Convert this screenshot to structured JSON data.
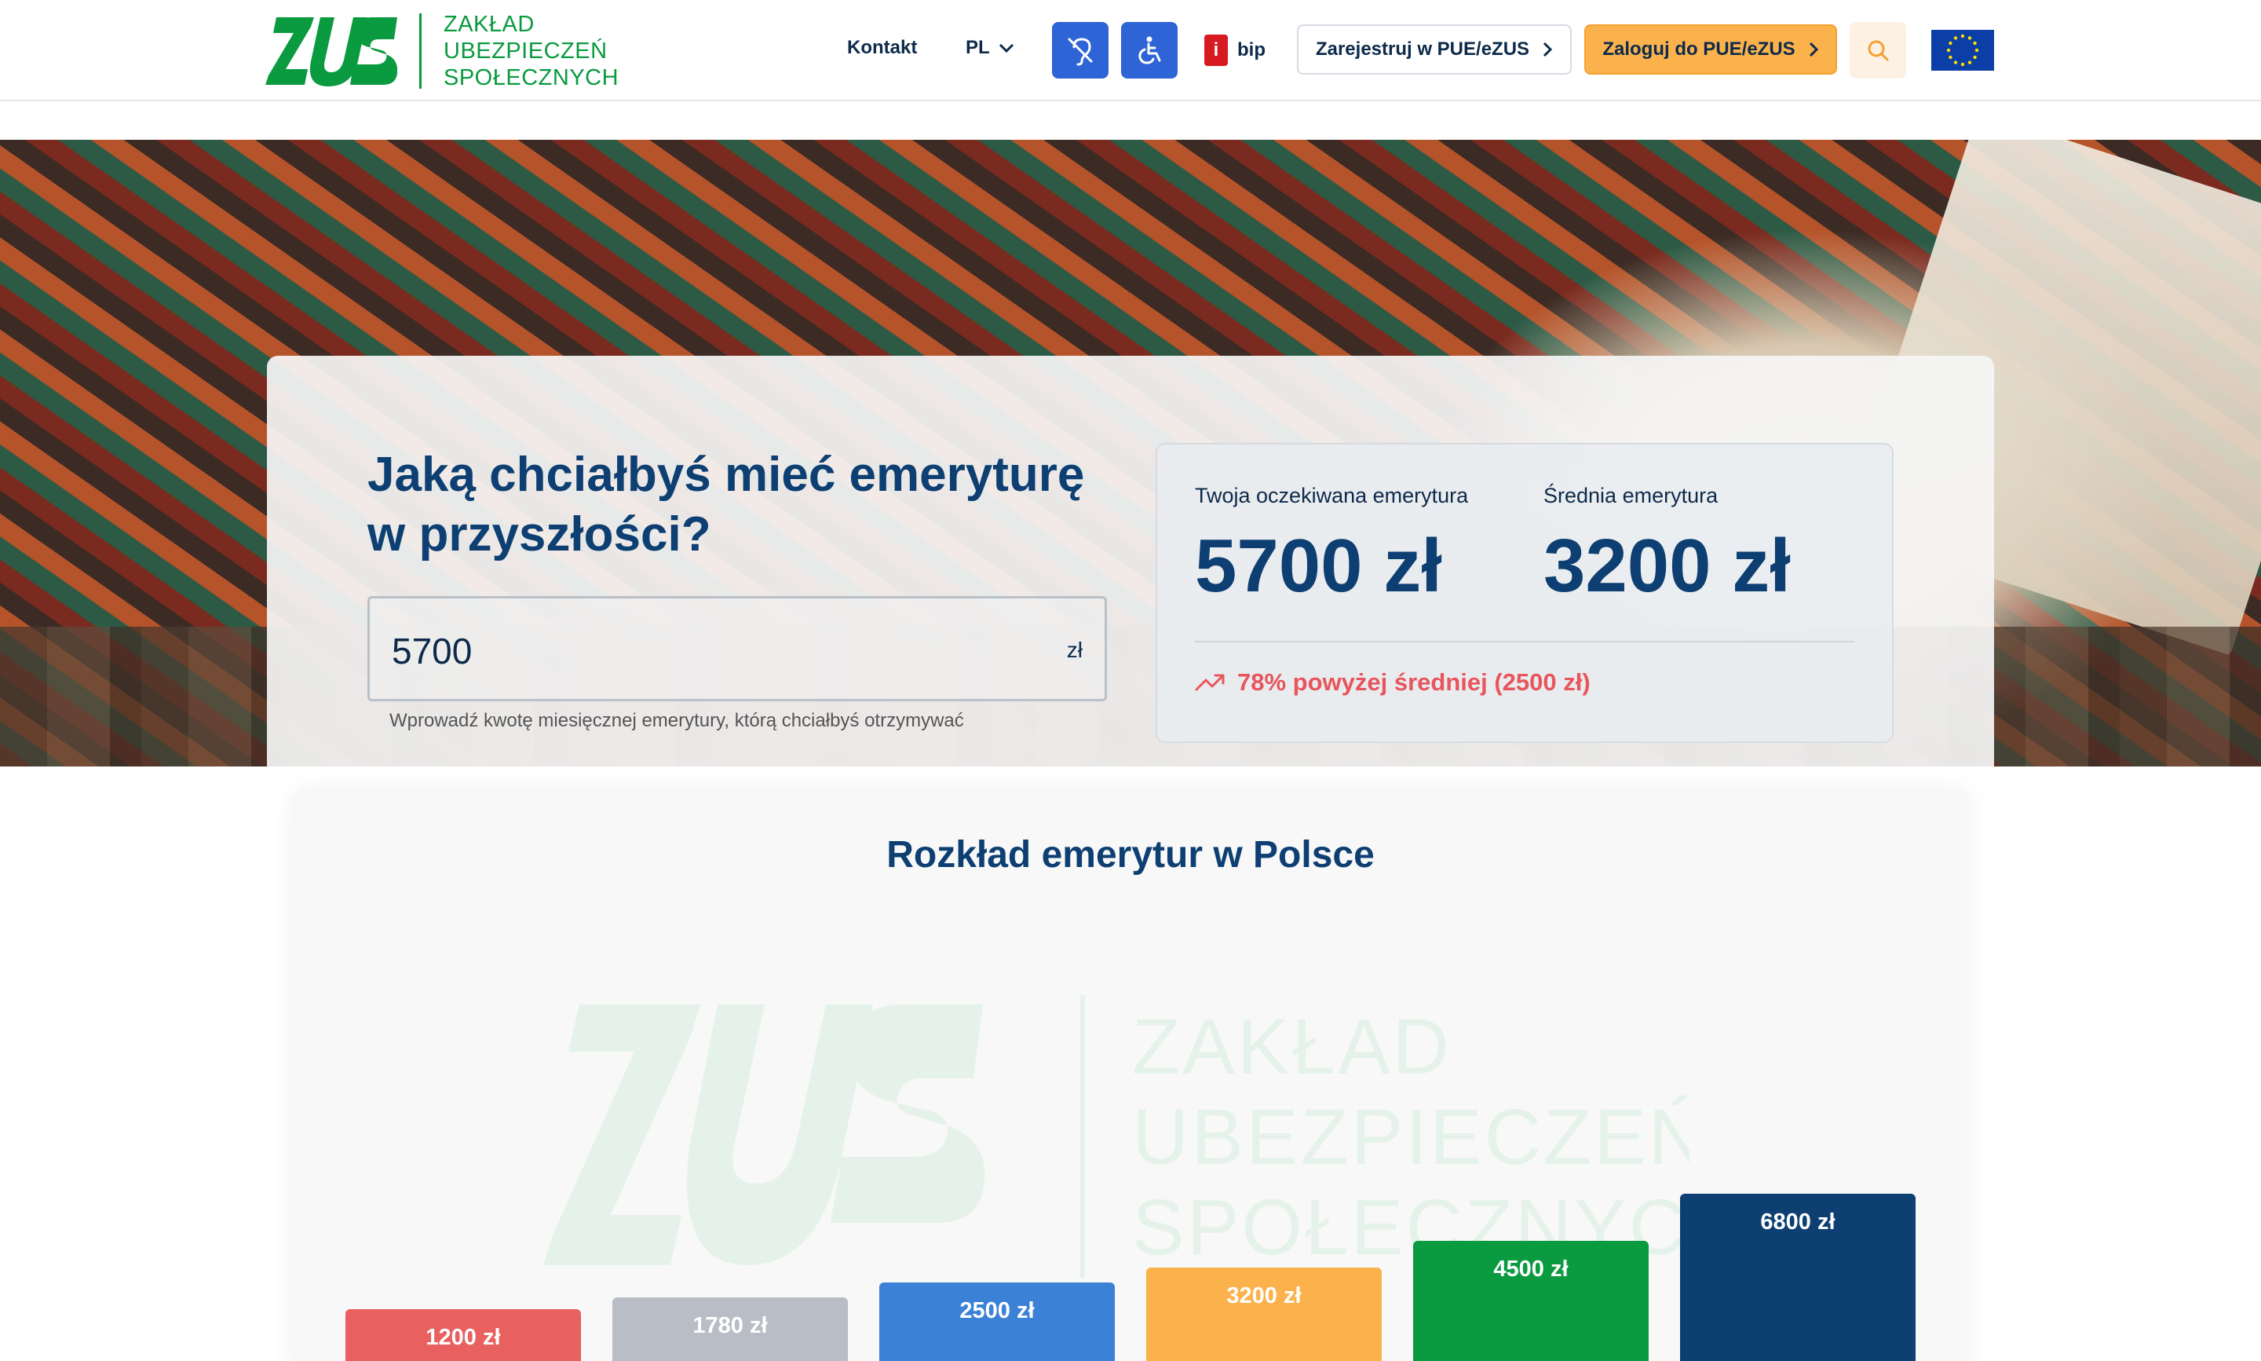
{
  "header": {
    "logo": {
      "mark": "ZUS",
      "lines": [
        "ZAKŁAD",
        "UBEZPIECZEŃ",
        "SPOŁECZNYCH"
      ],
      "color": "#0a9a3f"
    },
    "nav": {
      "kontakt": "Kontakt",
      "language": "PL"
    },
    "accessibility": {
      "hearing_icon": "ear-slash-icon",
      "wheelchair_icon": "wheelchair-icon"
    },
    "bip": {
      "badge": "i",
      "label": "bip"
    },
    "register_label": "Zarejestruj w PUE/eZUS",
    "login_label": "Zaloguj do PUE/eZUS",
    "search_icon": "search-icon",
    "eu_flag_icon": "eu-flag-icon"
  },
  "hero": {
    "title": "Jaką chciałbyś mieć emeryturę w przyszłości?",
    "input": {
      "value": "5700",
      "unit": "zł",
      "hint": "Wprowadź kwotę miesięcznej emerytury, którą chciałbyś otrzymywać"
    },
    "stats": {
      "expected_label": "Twoja oczekiwana emerytura",
      "expected_value": "5700 zł",
      "average_label": "Średnia emerytura",
      "average_value": "3200 zł",
      "comparison": "78% powyżej średniej (2500 zł)",
      "comparison_color": "#e8555c"
    }
  },
  "distribution": {
    "title": "Rozkład emerytur w Polsce",
    "watermark_lines": [
      "ZAKŁAD",
      "UBEZPIECZEŃ",
      "SPOŁECZNYCH"
    ],
    "watermark_mark": "ZUS"
  },
  "chart_data": {
    "type": "bar",
    "categories": [
      "1200 zł",
      "1780 zł",
      "2500 zł",
      "3200 zł",
      "4500 zł",
      "6800 zł"
    ],
    "values": [
      1200,
      1780,
      2500,
      3200,
      4500,
      6800
    ],
    "labels": [
      "1200 zł",
      "1780 zł",
      "2500 zł",
      "3200 zł",
      "4500 zł",
      "6800 zł"
    ],
    "colors": [
      "#e8605f",
      "#b9bdc5",
      "#3b82d6",
      "#fbb24c",
      "#0a9a3f",
      "#0d3f72"
    ],
    "title": "Rozkład emerytur w Polsce",
    "xlabel": "",
    "ylabel": "",
    "grid": false
  }
}
